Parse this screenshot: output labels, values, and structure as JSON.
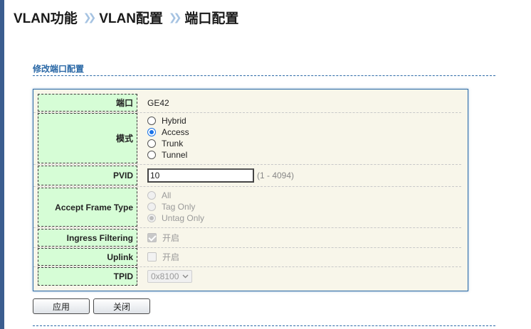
{
  "breadcrumb": {
    "items": [
      "VLAN功能",
      "VLAN配置",
      "端口配置"
    ],
    "separator": "❯❯"
  },
  "section": {
    "title": "修改端口配置"
  },
  "form": {
    "port": {
      "label": "端口",
      "value": "GE42"
    },
    "mode": {
      "label": "模式",
      "options": [
        "Hybrid",
        "Access",
        "Trunk",
        "Tunnel"
      ],
      "selected": "Access"
    },
    "pvid": {
      "label": "PVID",
      "value": "10",
      "range": "(1 - 4094)"
    },
    "accept_frame_type": {
      "label": "Accept Frame Type",
      "options": [
        "All",
        "Tag Only",
        "Untag Only"
      ],
      "selected": "Untag Only",
      "disabled": true
    },
    "ingress_filtering": {
      "label": "Ingress Filtering",
      "option_label": "开启",
      "checked": true,
      "disabled": true
    },
    "uplink": {
      "label": "Uplink",
      "option_label": "开启",
      "checked": false,
      "disabled": true
    },
    "tpid": {
      "label": "TPID",
      "value": "0x8100",
      "disabled": true
    }
  },
  "buttons": {
    "apply": "应用",
    "close": "关闭"
  },
  "colors": {
    "accent": "#2a68a6",
    "label_bg": "#d6fdd6",
    "form_bg": "#f8f6ea",
    "radio_checked": "#1a73e8"
  }
}
